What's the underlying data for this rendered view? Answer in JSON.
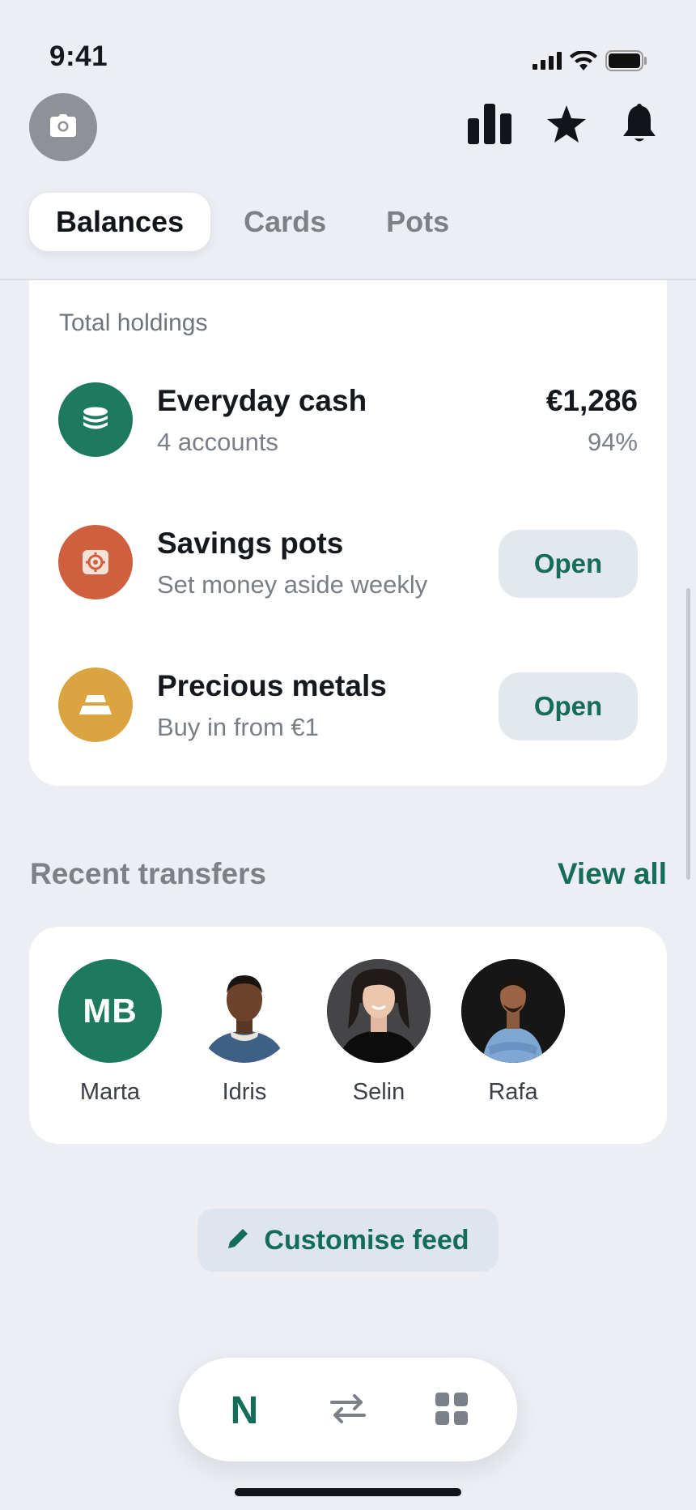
{
  "status_bar": {
    "time": "9:41",
    "icons": [
      "signal-icon",
      "wifi-icon",
      "battery-icon"
    ]
  },
  "top_bar": {
    "icons": [
      "camera-icon",
      "bar-chart-icon",
      "star-icon",
      "bell-icon"
    ]
  },
  "tabs": [
    {
      "label": "Balances",
      "active": true
    },
    {
      "label": "Cards",
      "active": false
    },
    {
      "label": "Pots",
      "active": false
    }
  ],
  "holdings": {
    "label": "Total holdings",
    "items": [
      {
        "title": "Everyday cash",
        "subtitle": "4 accounts",
        "amount": "€1,286",
        "percent": "94%",
        "icon": "coins-icon",
        "color": "#1e7a5f"
      },
      {
        "title": "Savings pots",
        "subtitle": "Set money aside weekly",
        "action": "Open",
        "icon": "safe-icon",
        "color": "#cf5f3d"
      },
      {
        "title": "Precious metals",
        "subtitle": "Buy in from €1",
        "action": "Open",
        "icon": "gold-bar-icon",
        "color": "#dba441"
      }
    ]
  },
  "recent_transfers": {
    "title": "Recent transfers",
    "view_all": "View all",
    "contacts": [
      {
        "name": "Marta",
        "initials": "MB"
      },
      {
        "name": "Idris"
      },
      {
        "name": "Selin"
      },
      {
        "name": "Rafa"
      }
    ]
  },
  "customise": {
    "label": "Customise feed",
    "icon": "pencil-icon"
  },
  "bottom_nav": {
    "items": [
      {
        "icon": "n-logo-icon",
        "label": "N",
        "active": true
      },
      {
        "icon": "transfer-arrows-icon",
        "active": false
      },
      {
        "icon": "grid-icon",
        "active": false
      }
    ]
  },
  "colors": {
    "accent": "#146d58",
    "background": "#eceef3",
    "card": "#ffffff"
  }
}
